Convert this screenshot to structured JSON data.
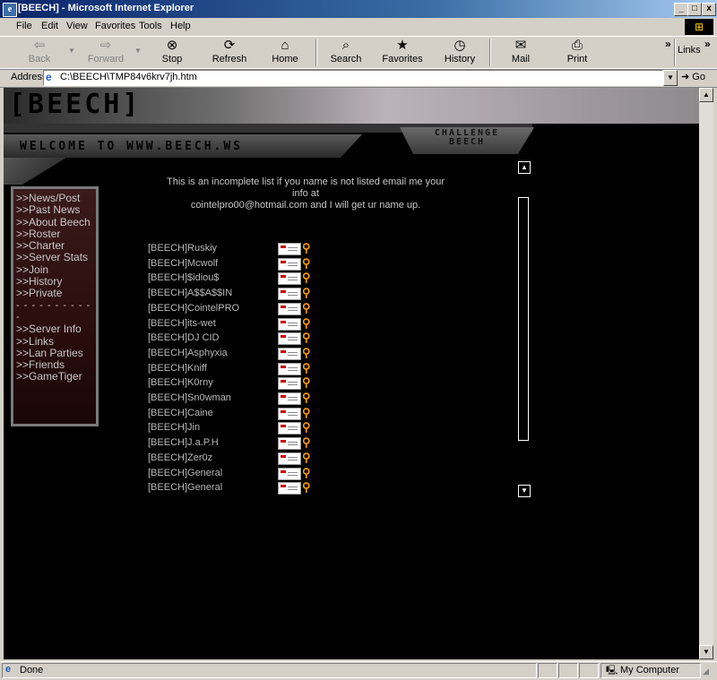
{
  "window": {
    "title": "[BEECH] - Microsoft Internet Explorer",
    "minimize": "_",
    "maximize": "□",
    "close": "x"
  },
  "menu": [
    "File",
    "Edit",
    "View",
    "Favorites",
    "Tools",
    "Help"
  ],
  "toolbar": {
    "back": "Back",
    "forward": "Forward",
    "stop": "Stop",
    "refresh": "Refresh",
    "home": "Home",
    "search": "Search",
    "favorites": "Favorites",
    "history": "History",
    "mail": "Mail",
    "print": "Print",
    "links": "Links",
    "overflow": "»"
  },
  "address": {
    "label": "Address",
    "value": "C:\\BEECH\\TMP84v6krv7jh.htm",
    "go": "Go"
  },
  "site": {
    "logo": "[BEECH]",
    "welcome": "WELCOME TO WWW.BEECH.WS",
    "challenge_line1": "CHALLENGE",
    "challenge_line2": "BEECH",
    "intro_line1": "This is an incomplete list if you name is not listed email me your info at",
    "intro_line2": "cointelpro00@hotmail.com and I will get ur name up.",
    "nav_primary": [
      ">>News/Post",
      ">>Past News",
      ">>About Beech",
      ">>Roster",
      ">>Charter",
      ">>Server Stats",
      ">>Join",
      ">>History",
      ">>Private"
    ],
    "nav_separator": "- - - - - - - - - - -",
    "nav_secondary": [
      ">>Server Info",
      ">>Links",
      ">>Lan Parties",
      ">>Friends",
      ">>GameTiger"
    ],
    "roster": [
      "[BEECH]Ruskiy",
      "[BEECH]Mcwolf",
      "[BEECH]$idiou$",
      "[BEECH]A$$A$$IN",
      "[BEECH]CointelPRO",
      "[BEECH]its-wet",
      "[BEECH]DJ CID",
      "[BEECH]Asphyxia",
      "[BEECH]Kniff",
      "[BEECH]K0rny",
      "[BEECH]Sn0wman",
      "[BEECH]Caine",
      "[BEECH]Jin",
      "[BEECH]J.a.P.H",
      "[BEECH]Zer0z",
      "[BEECH]General",
      "[BEECH]General"
    ]
  },
  "status": {
    "text": "Done",
    "zone": "My Computer"
  }
}
